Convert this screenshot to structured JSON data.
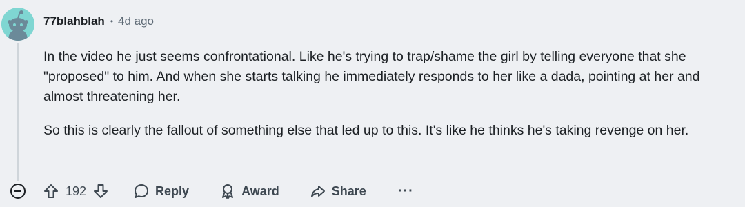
{
  "comment": {
    "username": "77blahblah",
    "separator": "•",
    "timestamp": "4d ago",
    "paragraphs": [
      "In the video he just seems confrontational. Like he's trying to trap/shame the girl by telling everyone that she \"proposed\" to him. And when she starts talking he immediately responds to her like a dada, pointing at her and almost threatening her.",
      "So this is clearly the fallout of something else that led up to this. It's like he thinks he's taking revenge on her."
    ],
    "vote_count": "192",
    "reply_label": "Reply",
    "award_label": "Award",
    "share_label": "Share",
    "more_label": "···"
  },
  "colors": {
    "background": "#eef0f3",
    "avatar": "#7fd6d2",
    "text": "#1c2024",
    "muted": "#5f6b76"
  }
}
